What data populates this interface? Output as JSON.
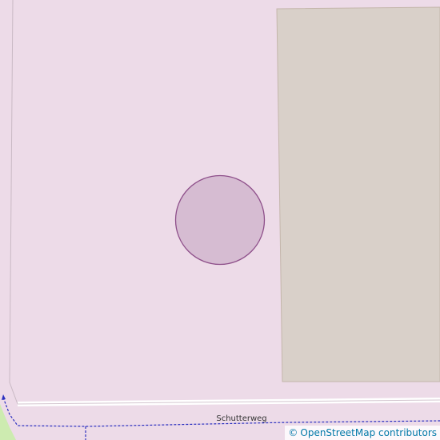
{
  "map": {
    "colors": {
      "background": "#eddbe8",
      "building": "#d9d0c9",
      "building_outline": "#c4b6ab",
      "marker_fill": "#d6bcd2",
      "marker_stroke": "#8e4f8a",
      "landuse_outline": "#c9b9c4",
      "grass": "#cdebb0",
      "road_casing": "#ffffff",
      "footway": "#2b2fbf"
    },
    "street_label": "Schutterweg",
    "attribution": {
      "symbol": "©",
      "link_text": "OpenStreetMap contributors"
    }
  }
}
